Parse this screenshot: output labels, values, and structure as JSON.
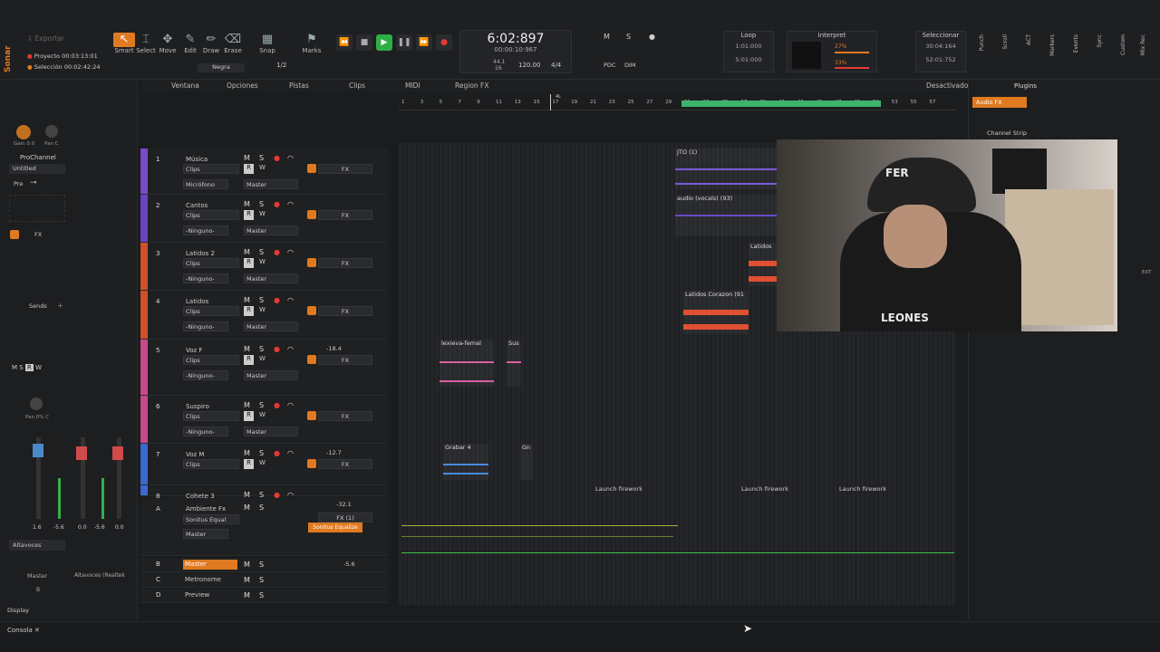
{
  "app": {
    "name": "Sonar"
  },
  "toolbar": {
    "export_label": "Exportar",
    "project_label": "Proyecto",
    "project_time": "00:03:13:01",
    "selection_label": "Selección",
    "selection_time": "00:02:42:24",
    "tools": [
      {
        "label": "Smart",
        "icon": "smart-tool-icon"
      },
      {
        "label": "Select",
        "icon": "select-tool-icon"
      },
      {
        "label": "Move",
        "icon": "move-tool-icon"
      },
      {
        "label": "Edit",
        "icon": "edit-tool-icon"
      },
      {
        "label": "Draw",
        "icon": "draw-tool-icon"
      },
      {
        "label": "Erase",
        "icon": "erase-tool-icon"
      }
    ],
    "snap_label": "Snap",
    "marks_label": "Marks",
    "snap_value": "1/2",
    "snap_mode": "Negra",
    "time_main": "6:02:897",
    "time_sub": "00:00:10:967",
    "sample_rate": "44.1",
    "bit_depth": "16",
    "tempo": "120.00",
    "meter": "4/4",
    "mode_pdc": "PDC",
    "mode_dim": "DIM",
    "loop_label": "Loop",
    "loop_start": "1:01:000",
    "loop_end": "5:01:000",
    "interpret_label": "Interpret",
    "cpu1": "27%",
    "cpu2": "33%",
    "select_label": "Seleccionar",
    "select_start": "30:04:164",
    "select_end": "52:01:752",
    "right_labels": [
      "Punch",
      "Scroll",
      "ACT",
      "Markers",
      "Events",
      "Sync",
      "Custom",
      "Mix Rec"
    ]
  },
  "menu": {
    "items": [
      "Ventana",
      "Opciones",
      "Pistas",
      "Clips",
      "MIDI",
      "Region FX"
    ],
    "right": "Desactivado"
  },
  "ruler": {
    "marks": [
      "1",
      "3",
      "5",
      "7",
      "9",
      "11",
      "13",
      "15",
      "17",
      "19",
      "21",
      "23",
      "25",
      "27",
      "29",
      "31",
      "33",
      "35",
      "37",
      "39",
      "41",
      "43",
      "45",
      "47",
      "49",
      "51",
      "53",
      "55",
      "57"
    ],
    "marker": "4L"
  },
  "inspector": {
    "gain_label": "Gain 0.0",
    "pan_label": "Pan C",
    "prochannel": "ProChannel",
    "untitled": "Untitled",
    "pre": "Pre",
    "fx": "FX",
    "sends": "Sends",
    "pan_value": "Pan 0% C",
    "left_vals": [
      "1.6",
      "-5.6"
    ],
    "right_vals": [
      "0.0",
      "-5.6",
      "0.0"
    ],
    "output": "Altavoces",
    "output_right": "Altavoces (Realtek",
    "master_label": "Master",
    "master_b": "B",
    "display": "Display",
    "msr": [
      "M",
      "S",
      "R",
      "W"
    ]
  },
  "tracks": [
    {
      "num": "1",
      "name": "Música",
      "color": "#7a4ac8",
      "clips": "Clips",
      "input": "Micrófono",
      "output": "Master",
      "fx": "FX",
      "vol": ""
    },
    {
      "num": "2",
      "name": "Cantos",
      "color": "#6b44c2",
      "clips": "Clips",
      "input": "-Ninguno-",
      "output": "Master",
      "fx": "FX",
      "vol": ""
    },
    {
      "num": "3",
      "name": "Latidos 2",
      "color": "#d0502a",
      "clips": "Clips",
      "input": "-Ninguno-",
      "output": "Master",
      "fx": "FX",
      "vol": ""
    },
    {
      "num": "4",
      "name": "Latidos",
      "color": "#d0502a",
      "clips": "Clips",
      "input": "-Ninguno-",
      "output": "Master",
      "fx": "FX",
      "vol": ""
    },
    {
      "num": "5",
      "name": "Voz F",
      "color": "#c84a8a",
      "clips": "Clips",
      "input": "-Ninguno-",
      "output": "Master",
      "fx": "FX",
      "vol": "-18.4"
    },
    {
      "num": "6",
      "name": "Suspiro",
      "color": "#c84a8a",
      "clips": "Clips",
      "input": "-Ninguno-",
      "output": "Master",
      "fx": "FX",
      "vol": ""
    },
    {
      "num": "7",
      "name": "Voz M",
      "color": "#3a6ad0",
      "clips": "Clips",
      "input": "",
      "output": "",
      "fx": "FX",
      "vol": "-12.7"
    },
    {
      "num": "8",
      "name": "Cohete 3",
      "color": "#3a6ad0",
      "clips": "",
      "input": "",
      "output": "",
      "fx": "",
      "vol": ""
    }
  ],
  "bus": {
    "letter": "A",
    "name": "Ambiente Fx",
    "vol": "-32.1",
    "plugin": "Sonitus Equal",
    "output": "Master",
    "fx": "FX (1)",
    "fx_label": "Sonitus Equalize"
  },
  "masters": [
    {
      "letter": "B",
      "name": "Master",
      "vol": "-5.6"
    },
    {
      "letter": "C",
      "name": "Metronome",
      "vol": ""
    },
    {
      "letter": "D",
      "name": "Preview",
      "vol": ""
    }
  ],
  "clips": {
    "c1": "JTO (1)",
    "c2": "audio (vocals) (93)",
    "c3": "Latidos",
    "c4": "Latidos Corazon (91",
    "c5": "lexieva-femal",
    "c6": "Sus",
    "c7": "Grabar 4",
    "c8": "Gn",
    "fireworks": [
      "Launch firework",
      "Launch firework",
      "Launch firework"
    ]
  },
  "browser": {
    "tab": "Plugins",
    "audio_fx": "Audio FX",
    "channel_strip": "Channel Strip",
    "ext": "EXT"
  },
  "status": {
    "console": "Consola"
  },
  "webcam": {
    "cap_text": "FER",
    "shirt_text": "LEONES"
  }
}
